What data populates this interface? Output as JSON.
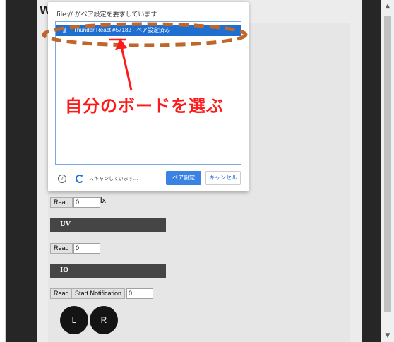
{
  "page": {
    "title": "We"
  },
  "dialog": {
    "title": "file:// がペア設定を要求しています",
    "device_label": "Thunder React #57182 - ペア設定済み",
    "scanning_text": "スキャンしています...",
    "pair_button": "ペア設定",
    "cancel_button": "キャンセル",
    "help_icon": "?"
  },
  "annotation": {
    "text": "自分のボードを選ぶ",
    "color": "#ff1a1a",
    "ellipse_color": "#c0662b"
  },
  "sensors": {
    "light": {
      "read_label": "Read",
      "value": "0",
      "unit": "lx"
    },
    "uv": {
      "header": "UV",
      "read_label": "Read",
      "value": "0"
    },
    "io": {
      "header": "IO",
      "read_label": "Read",
      "notify_label": "Start Notification",
      "value": "0"
    }
  },
  "buttons": {
    "left": "L",
    "right": "R"
  },
  "colors": {
    "accent": "#1f6fd1",
    "section_bar": "#454545"
  }
}
